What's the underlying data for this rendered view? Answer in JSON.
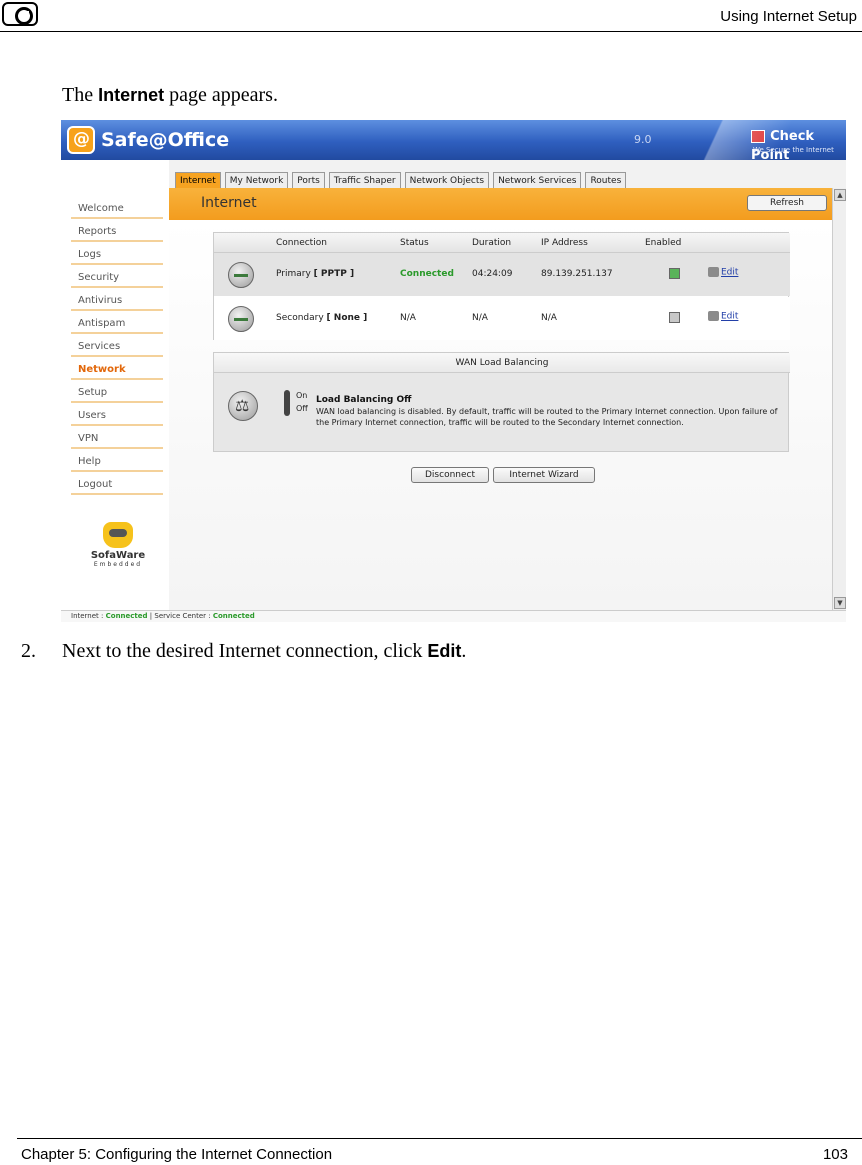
{
  "document": {
    "header_title": "Using Internet Setup",
    "intro_prefix": "The",
    "intro_bold": "Internet",
    "intro_suffix": "page appears.",
    "step_number": "2.",
    "step_text": "Next to the desired Internet connection, click",
    "step_bold": "Edit",
    "step_end": ".",
    "footer_left": "Chapter 5: Configuring the Internet Connection",
    "footer_right": "103"
  },
  "app": {
    "name": "Safe@Office",
    "version": "9.0",
    "vendor": "Check Point",
    "vendor_tagline": "We Secure the Internet"
  },
  "sidebar": {
    "items": [
      {
        "label": "Welcome",
        "active": false
      },
      {
        "label": "Reports",
        "active": false
      },
      {
        "label": "Logs",
        "active": false
      },
      {
        "label": "Security",
        "active": false
      },
      {
        "label": "Antivirus",
        "active": false
      },
      {
        "label": "Antispam",
        "active": false
      },
      {
        "label": "Services",
        "active": false
      },
      {
        "label": "Network",
        "active": true
      },
      {
        "label": "Setup",
        "active": false
      },
      {
        "label": "Users",
        "active": false
      },
      {
        "label": "VPN",
        "active": false
      },
      {
        "label": "Help",
        "active": false
      },
      {
        "label": "Logout",
        "active": false
      }
    ],
    "brand": "SofaWare",
    "brand_sub": "Embedded"
  },
  "tabs": [
    {
      "label": "Internet",
      "active": true
    },
    {
      "label": "My Network",
      "active": false
    },
    {
      "label": "Ports",
      "active": false
    },
    {
      "label": "Traffic Shaper",
      "active": false
    },
    {
      "label": "Network Objects",
      "active": false
    },
    {
      "label": "Network Services",
      "active": false
    },
    {
      "label": "Routes",
      "active": false
    }
  ],
  "page": {
    "title": "Internet",
    "refresh_label": "Refresh"
  },
  "connections": {
    "headers": [
      "Connection",
      "Status",
      "Duration",
      "IP Address",
      "Enabled"
    ],
    "rows": [
      {
        "name": "Primary",
        "type": "[ PPTP ]",
        "status": "Connected",
        "duration": "04:24:09",
        "ip": "89.139.251.137",
        "enabled": true,
        "edit": "Edit"
      },
      {
        "name": "Secondary",
        "type": "[ None ]",
        "status": "N/A",
        "duration": "N/A",
        "ip": "N/A",
        "enabled": false,
        "edit": "Edit"
      }
    ]
  },
  "wan": {
    "header": "WAN Load Balancing",
    "on_label": "On",
    "off_label": "Off",
    "title": "Load Balancing Off",
    "description": "WAN load balancing is disabled. By default, traffic will be routed to the Primary Internet connection. Upon failure of the Primary Internet connection, traffic will be routed to the Secondary Internet connection."
  },
  "buttons": {
    "disconnect": "Disconnect",
    "wizard": "Internet Wizard"
  },
  "statusbar": {
    "internet_label": "Internet :",
    "internet_status": "Connected",
    "service_label": "Service Center :",
    "service_status": "Connected"
  },
  "colors": {
    "accent_orange": "#f39c1e",
    "title_blue": "#2f5fbf",
    "connected_green": "#2b9a2b",
    "link_blue": "#223fa8"
  }
}
